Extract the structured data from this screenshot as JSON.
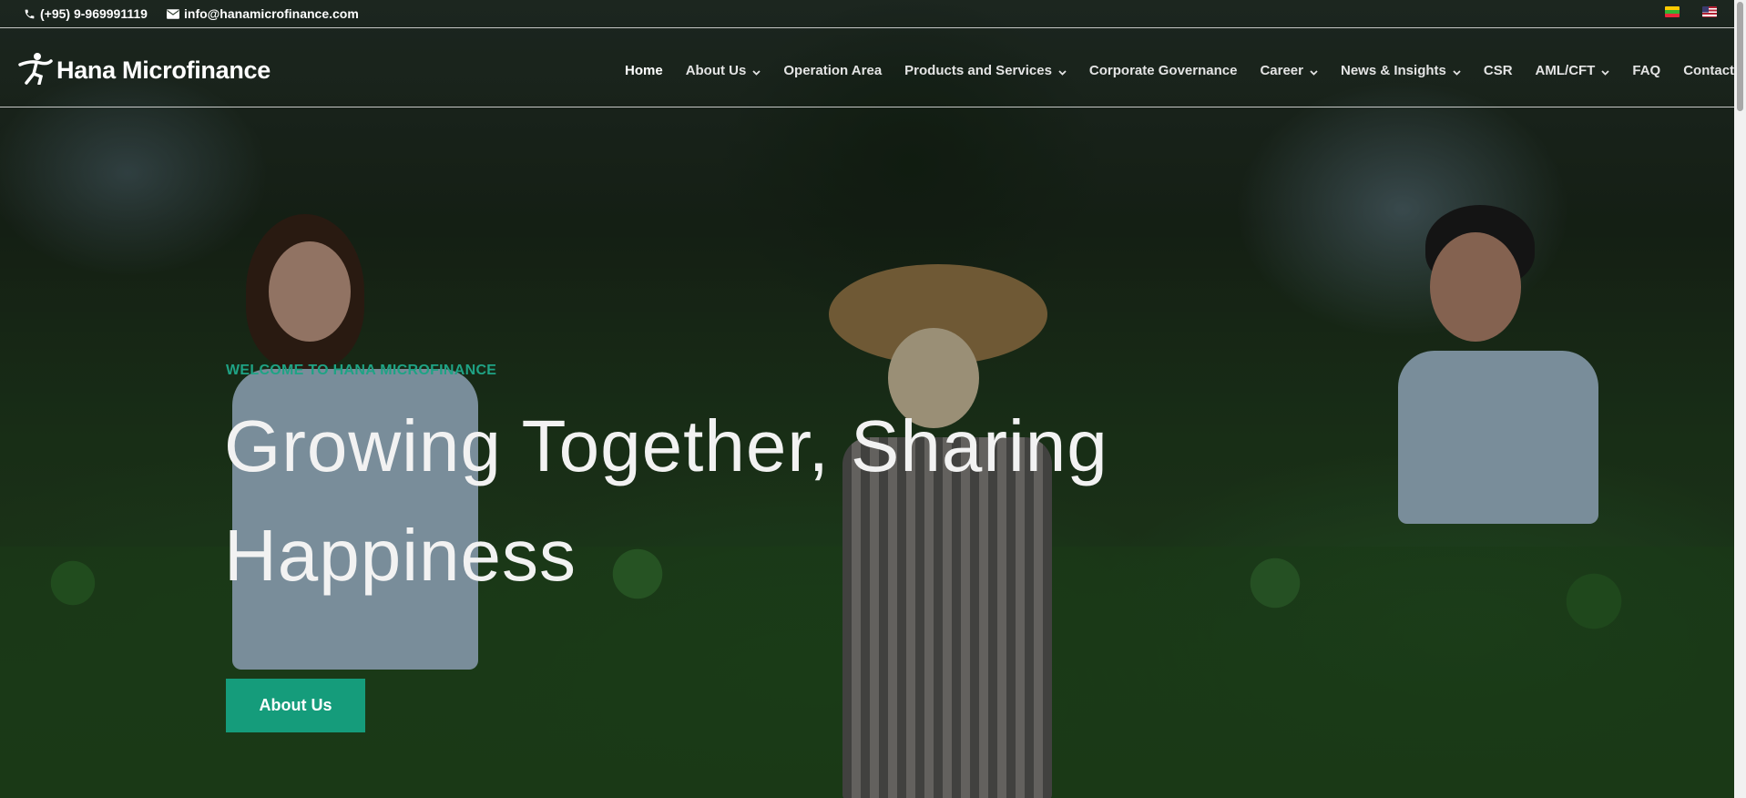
{
  "topbar": {
    "phone": "(+95) 9-969991119",
    "email": "info@hanamicrofinance.com",
    "languages": [
      "Myanmar",
      "English"
    ]
  },
  "header": {
    "logo_text": "Hana Microfinance",
    "nav": [
      {
        "label": "Home",
        "dropdown": false,
        "active": true
      },
      {
        "label": "About Us",
        "dropdown": true
      },
      {
        "label": "Operation Area",
        "dropdown": false
      },
      {
        "label": "Products and Services",
        "dropdown": true
      },
      {
        "label": "Corporate Governance",
        "dropdown": false
      },
      {
        "label": "Career",
        "dropdown": true
      },
      {
        "label": "News & Insights",
        "dropdown": true
      },
      {
        "label": "CSR",
        "dropdown": false
      },
      {
        "label": "AML/CFT",
        "dropdown": true
      },
      {
        "label": "FAQ",
        "dropdown": false
      },
      {
        "label": "Contact Us",
        "dropdown": false
      }
    ]
  },
  "hero": {
    "eyebrow": "WELCOME TO HANA MICROFINANCE",
    "headline_line1": "Growing Together, Sharing",
    "headline_line2": "Happiness",
    "cta_label": "About Us"
  },
  "colors": {
    "accent": "#159c7b",
    "eyebrow": "#1fa385"
  }
}
